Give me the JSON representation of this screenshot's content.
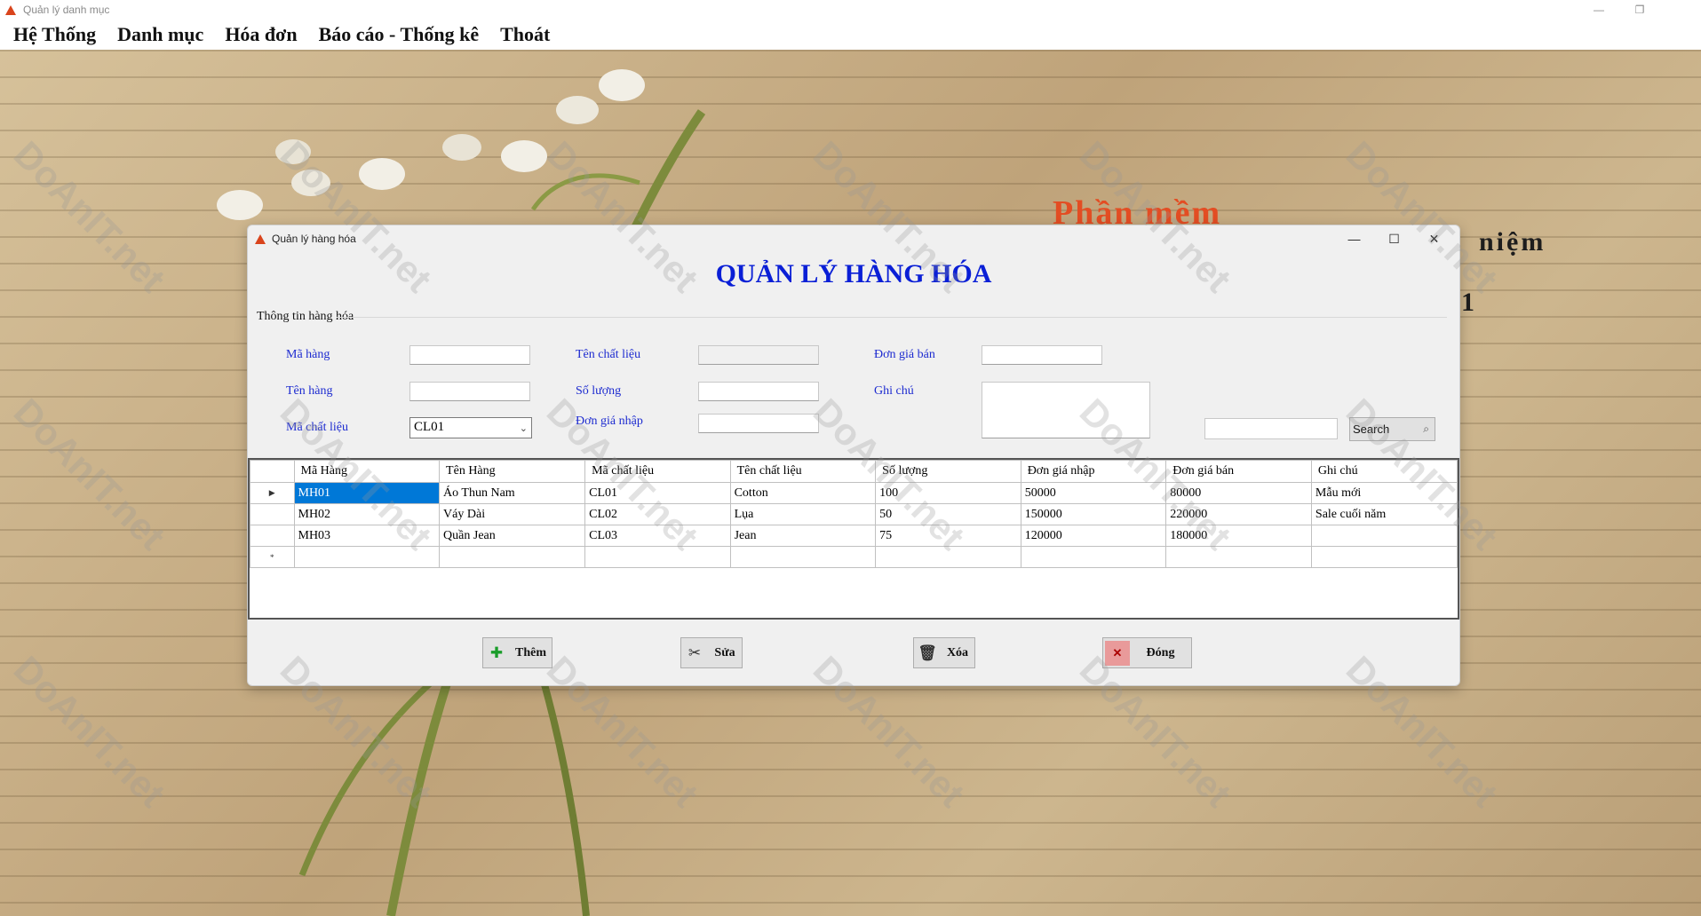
{
  "app": {
    "window_title": "Quản lý danh mục",
    "controls": [
      "—",
      "❐",
      ""
    ]
  },
  "menu": [
    "Hệ Thống",
    "Danh mục",
    "Hóa đơn",
    "Báo cáo - Thống kê",
    "Thoát"
  ],
  "background": {
    "headline": "Phần mềm",
    "headline_suffix": "niệm",
    "headline_digit": "1"
  },
  "form": {
    "window_title": "Quản lý hàng hóa",
    "heading": "QUẢN LÝ HÀNG HÓA",
    "group_title": "Thông tin hàng hóa",
    "labels": {
      "ma_hang": "Mã hàng",
      "ten_hang": "Tên hàng",
      "ma_chat_lieu": "Mã chất liệu",
      "ten_chat_lieu": "Tên chất liệu",
      "so_luong": "Số lượng",
      "don_gia_nhap": "Đơn giá nhập",
      "don_gia_ban": "Đơn giá bán",
      "ghi_chu": "Ghi chú"
    },
    "combo_value": "CL01",
    "search_label": "Search",
    "grid": {
      "columns": [
        "Mã Hàng",
        "Tên Hàng",
        "Mã chất liệu",
        "Tên chất liệu",
        "Số lượng",
        "Đơn giá nhập",
        "Đơn giá bán",
        "Ghi chú"
      ],
      "rows": [
        [
          "MH01",
          "Áo Thun Nam",
          "CL01",
          "Cotton",
          "100",
          "50000",
          "80000",
          "Mẫu mới"
        ],
        [
          "MH02",
          "Váy Dài",
          "CL02",
          "Lụa",
          "50",
          "150000",
          "220000",
          "Sale cuối năm"
        ],
        [
          "MH03",
          "Quần Jean",
          "CL03",
          "Jean",
          "75",
          "120000",
          "180000",
          ""
        ]
      ],
      "current_row_marker": "▶",
      "new_row_marker": "*"
    },
    "buttons": {
      "them": "Thêm",
      "sua": "Sửa",
      "xoa": "Xóa",
      "dong": "Đóng"
    }
  },
  "watermark": "DoAnIT.net",
  "colors": {
    "heading": "#0a1fd6",
    "label": "#1d2bd0",
    "selection": "#0078d7",
    "background_headline": "#e34d23"
  }
}
